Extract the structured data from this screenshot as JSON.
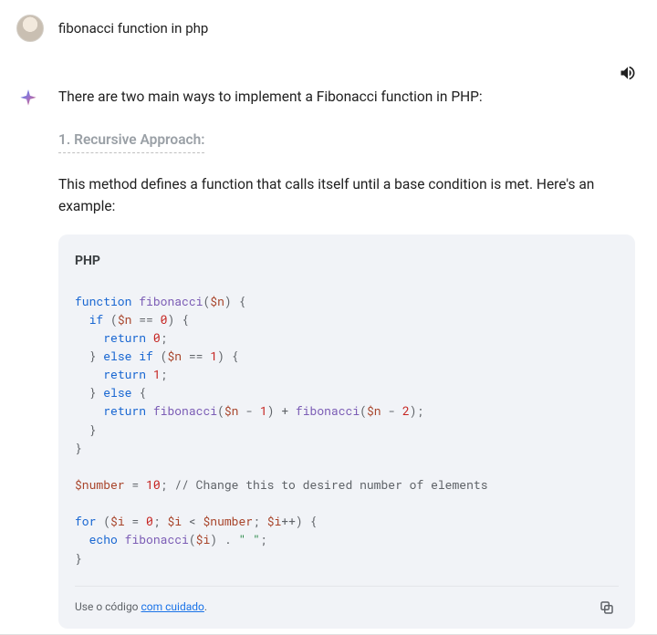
{
  "user": {
    "prompt": "fibonacci function in php"
  },
  "assistant": {
    "intro": "There are two main ways to implement a Fibonacci function in PHP:",
    "section_title": "1. Recursive Approach:",
    "section_desc": "This method defines a function that calls itself until a base condition is met. Here's an example:",
    "code": {
      "language": "PHP",
      "raw": "function fibonacci($n) {\n  if ($n == 0) {\n    return 0;\n  } else if ($n == 1) {\n    return 1;\n  } else {\n    return fibonacci($n - 1) + fibonacci($n - 2);\n  }\n}\n\n$number = 10; // Change this to desired number of elements\n\nfor ($i = 0; $i < $number; $i++) {\n  echo fibonacci($i) . \" \";\n}",
      "tokens": [
        [
          [
            "function",
            "kw"
          ],
          [
            " "
          ],
          [
            "fibonacci",
            "fn"
          ],
          [
            "(",
            "op"
          ],
          [
            "$n",
            "var"
          ],
          [
            ")",
            "op"
          ],
          [
            " {",
            "op"
          ]
        ],
        [
          [
            "  "
          ],
          [
            "if",
            "kw"
          ],
          [
            " (",
            "op"
          ],
          [
            "$n",
            "var"
          ],
          [
            " == ",
            "op"
          ],
          [
            "0",
            "num"
          ],
          [
            ") {",
            "op"
          ]
        ],
        [
          [
            "    "
          ],
          [
            "return",
            "kw"
          ],
          [
            " ",
            "op"
          ],
          [
            "0",
            "num"
          ],
          [
            ";",
            "op"
          ]
        ],
        [
          [
            "  } ",
            "op"
          ],
          [
            "else if",
            "kw"
          ],
          [
            " (",
            "op"
          ],
          [
            "$n",
            "var"
          ],
          [
            " == ",
            "op"
          ],
          [
            "1",
            "num"
          ],
          [
            ") {",
            "op"
          ]
        ],
        [
          [
            "    "
          ],
          [
            "return",
            "kw"
          ],
          [
            " ",
            "op"
          ],
          [
            "1",
            "num"
          ],
          [
            ";",
            "op"
          ]
        ],
        [
          [
            "  } ",
            "op"
          ],
          [
            "else",
            "kw"
          ],
          [
            " {",
            "op"
          ]
        ],
        [
          [
            "    "
          ],
          [
            "return",
            "kw"
          ],
          [
            " "
          ],
          [
            "fibonacci",
            "fn"
          ],
          [
            "(",
            "op"
          ],
          [
            "$n",
            "var"
          ],
          [
            " - ",
            "op"
          ],
          [
            "1",
            "num"
          ],
          [
            ")",
            "op"
          ],
          [
            " + ",
            "op"
          ],
          [
            "fibonacci",
            "fn"
          ],
          [
            "(",
            "op"
          ],
          [
            "$n",
            "var"
          ],
          [
            " - ",
            "op"
          ],
          [
            "2",
            "num"
          ],
          [
            ");",
            "op"
          ]
        ],
        [
          [
            "  }",
            "op"
          ]
        ],
        [
          [
            "}",
            "op"
          ]
        ],
        [
          [
            ""
          ]
        ],
        [
          [
            "$number",
            "var"
          ],
          [
            " = ",
            "op"
          ],
          [
            "10",
            "num"
          ],
          [
            "; ",
            "op"
          ],
          [
            "// Change this to desired number of elements",
            "cmt"
          ]
        ],
        [
          [
            ""
          ]
        ],
        [
          [
            "for",
            "kw"
          ],
          [
            " (",
            "op"
          ],
          [
            "$i",
            "var"
          ],
          [
            " = ",
            "op"
          ],
          [
            "0",
            "num"
          ],
          [
            "; ",
            "op"
          ],
          [
            "$i",
            "var"
          ],
          [
            " < ",
            "op"
          ],
          [
            "$number",
            "var"
          ],
          [
            "; ",
            "op"
          ],
          [
            "$i",
            "var"
          ],
          [
            "++) {",
            "op"
          ]
        ],
        [
          [
            "  "
          ],
          [
            "echo",
            "kw"
          ],
          [
            " "
          ],
          [
            "fibonacci",
            "fn"
          ],
          [
            "(",
            "op"
          ],
          [
            "$i",
            "var"
          ],
          [
            ")",
            "op"
          ],
          [
            " . ",
            "op"
          ],
          [
            "\" \"",
            "str"
          ],
          [
            ";",
            "op"
          ]
        ],
        [
          [
            "}",
            "op"
          ]
        ]
      ]
    },
    "footer": {
      "prefix": "Use o código ",
      "link_text": "com cuidado",
      "suffix": "."
    }
  }
}
